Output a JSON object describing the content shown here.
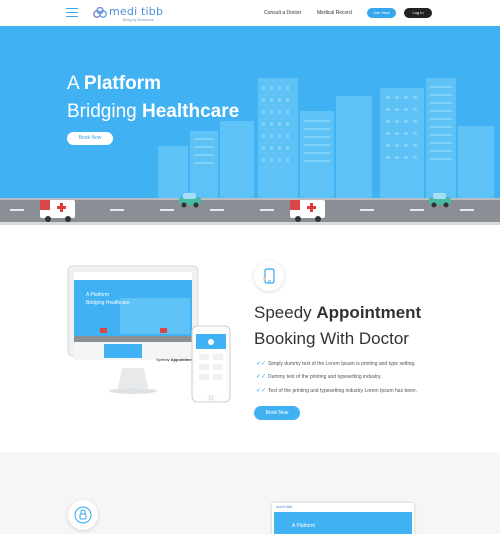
{
  "header": {
    "logo_text": "medi tibb",
    "logo_tagline": "Bridging Healthcare",
    "nav": [
      "Consult a Doctor",
      "Medical Record"
    ],
    "join_label": "Join Now",
    "login_label": "Log In"
  },
  "hero": {
    "line1_light": "A ",
    "line1_bold": "Platform",
    "line2_light": "Bridging ",
    "line2_bold": "Healthcare",
    "button": "Book Now"
  },
  "feature": {
    "title1_light": "Speedy ",
    "title1_bold": "Appointment",
    "title2": "Booking With Doctor",
    "bullets": [
      "Simply dummy text of the Lorem Ipsum is printing and type setting.",
      "Dummy text of the printing and typesetting industry.",
      "Text of the printing and typesetting industry Lorem Ipsum has been."
    ],
    "button": "Book Now",
    "laptop_title1": "A Platform",
    "laptop_title2": "Bridging Healthcare",
    "laptop_caption_light": "Speedy ",
    "laptop_caption_bold": "Appointment"
  },
  "preview": {
    "logo": "medi tibb",
    "title": "A Platform"
  },
  "colors": {
    "accent": "#35a7ef",
    "hero_bg": "#40b2f3",
    "dark_button": "#222222"
  },
  "icons": [
    "hamburger-icon",
    "logo-icon",
    "phone-icon",
    "checkmark-icon",
    "lock-icon",
    "ambulance-icon",
    "car-icon"
  ]
}
